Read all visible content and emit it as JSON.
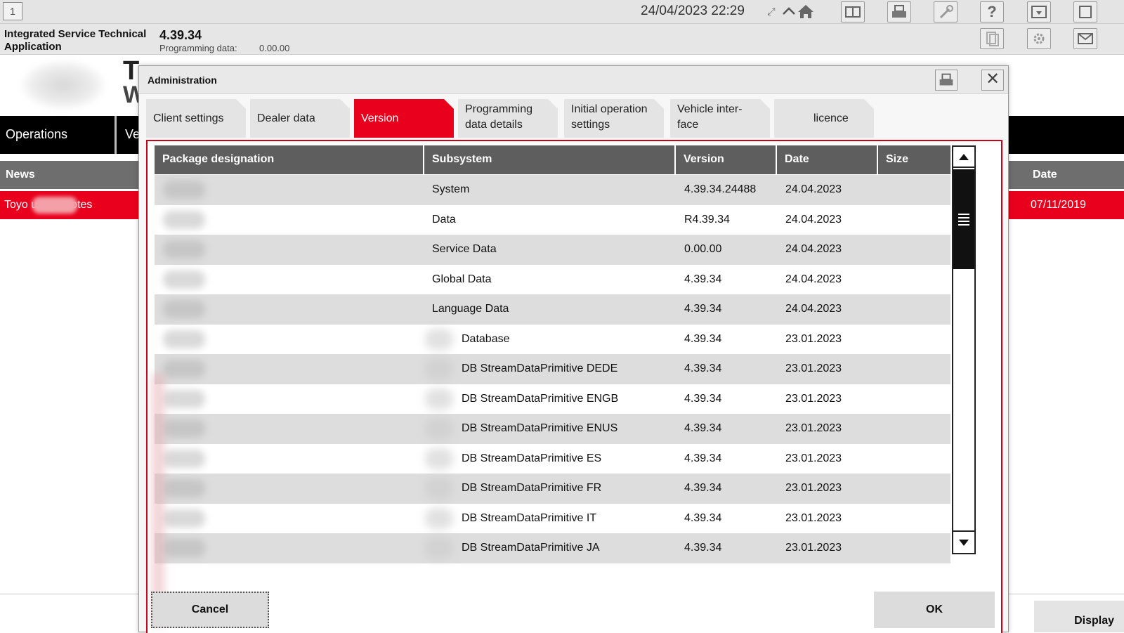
{
  "topbar": {
    "window_number": "1",
    "datetime": "24/04/2023 22:29",
    "icons": [
      "expand-icon",
      "chevron-up-icon",
      "home-icon",
      "panel-icon",
      "print-icon",
      "wrench-icon",
      "help-icon",
      "dropdown-icon",
      "window-icon",
      "document-icon",
      "settings-icon",
      "mail-icon"
    ],
    "help_glyph": "?"
  },
  "app": {
    "name": "Integrated Service Technical Application",
    "version": "4.39.34",
    "programming_data_label": "Programming data:",
    "programming_data_value": "0.00.00"
  },
  "background": {
    "title_line1": "T",
    "title_line2": "W",
    "nav": {
      "operations": "Operations",
      "second": "Ve"
    },
    "news": {
      "label": "News",
      "date_label": "Date",
      "row_text": "Toyo        usage notes",
      "row_date": "07/11/2019"
    },
    "display_button": "Display"
  },
  "dialog": {
    "title": "Administration",
    "close_glyph": "✕",
    "tabs": [
      {
        "label": "Client settings",
        "active": false
      },
      {
        "label": "Dealer data",
        "active": false
      },
      {
        "label": "Version",
        "active": true
      },
      {
        "label": "Programming data details",
        "active": false
      },
      {
        "label": "Initial operation settings",
        "active": false
      },
      {
        "label": "Vehicle inter-face",
        "active": false
      },
      {
        "label": "licence",
        "active": false
      }
    ],
    "table": {
      "headers": [
        "Package designation",
        "Subsystem",
        "Version",
        "Date",
        "Size"
      ],
      "rows": [
        {
          "package": "",
          "subsystem": "System",
          "version": "4.39.34.24488",
          "date": "24.04.2023",
          "size": ""
        },
        {
          "package": "",
          "subsystem": "Data",
          "version": "R4.39.34",
          "date": "24.04.2023",
          "size": ""
        },
        {
          "package": "",
          "subsystem": "Service Data",
          "version": "0.00.00",
          "date": "24.04.2023",
          "size": ""
        },
        {
          "package": "",
          "subsystem": "Global Data",
          "version": "4.39.34",
          "date": "24.04.2023",
          "size": ""
        },
        {
          "package": "",
          "subsystem": "Language Data",
          "version": "4.39.34",
          "date": "24.04.2023",
          "size": ""
        },
        {
          "package": "",
          "subsystem": "Database",
          "version": "4.39.34",
          "date": "23.01.2023",
          "size": ""
        },
        {
          "package": "",
          "subsystem": "DB StreamDataPrimitive DEDE",
          "version": "4.39.34",
          "date": "23.01.2023",
          "size": ""
        },
        {
          "package": "",
          "subsystem": "DB StreamDataPrimitive ENGB",
          "version": "4.39.34",
          "date": "23.01.2023",
          "size": ""
        },
        {
          "package": "",
          "subsystem": "DB StreamDataPrimitive ENUS",
          "version": "4.39.34",
          "date": "23.01.2023",
          "size": ""
        },
        {
          "package": "",
          "subsystem": "DB StreamDataPrimitive ES",
          "version": "4.39.34",
          "date": "23.01.2023",
          "size": ""
        },
        {
          "package": "",
          "subsystem": "DB StreamDataPrimitive FR",
          "version": "4.39.34",
          "date": "23.01.2023",
          "size": ""
        },
        {
          "package": "",
          "subsystem": "DB StreamDataPrimitive IT",
          "version": "4.39.34",
          "date": "23.01.2023",
          "size": ""
        },
        {
          "package": "",
          "subsystem": "DB StreamDataPrimitive JA",
          "version": "4.39.34",
          "date": "23.01.2023",
          "size": ""
        }
      ]
    },
    "buttons": {
      "cancel": "Cancel",
      "ok": "OK"
    }
  },
  "colors": {
    "accent": "#e8001c",
    "header_gray": "#5e5e5e",
    "row_alt": "#dddddd"
  }
}
